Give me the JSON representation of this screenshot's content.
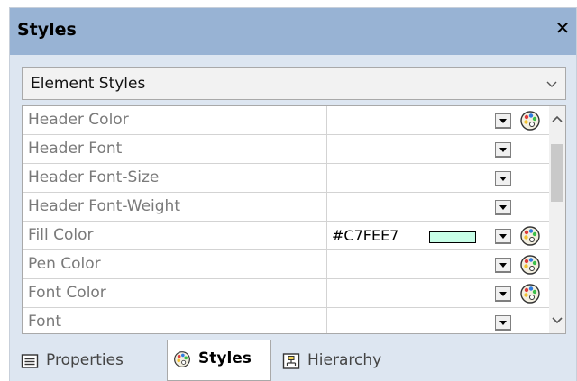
{
  "window": {
    "title": "Styles",
    "close_glyph": "✕"
  },
  "style_selector": {
    "selected": "Element Styles"
  },
  "properties": [
    {
      "name": "Header Color",
      "value": "",
      "has_palette": true
    },
    {
      "name": "Header Font",
      "value": "",
      "has_palette": false
    },
    {
      "name": "Header Font-Size",
      "value": "",
      "has_palette": false
    },
    {
      "name": "Header Font-Weight",
      "value": "",
      "has_palette": false
    },
    {
      "name": "Fill Color",
      "value": "#C7FEE7",
      "swatch": "#C7FEE7",
      "has_palette": true
    },
    {
      "name": "Pen Color",
      "value": "",
      "has_palette": true
    },
    {
      "name": "Font Color",
      "value": "",
      "has_palette": true
    },
    {
      "name": "Font",
      "value": "",
      "has_palette": false
    }
  ],
  "tabs": [
    {
      "label": "Properties",
      "icon": "properties-icon",
      "active": false
    },
    {
      "label": "Styles",
      "icon": "palette-icon",
      "active": true
    },
    {
      "label": "Hierarchy",
      "icon": "hierarchy-icon",
      "active": false
    }
  ],
  "colors": {
    "title_bar": "#98b3d4",
    "panel_bg": "#dde6f1",
    "fill_swatch": "#C7FEE7"
  }
}
